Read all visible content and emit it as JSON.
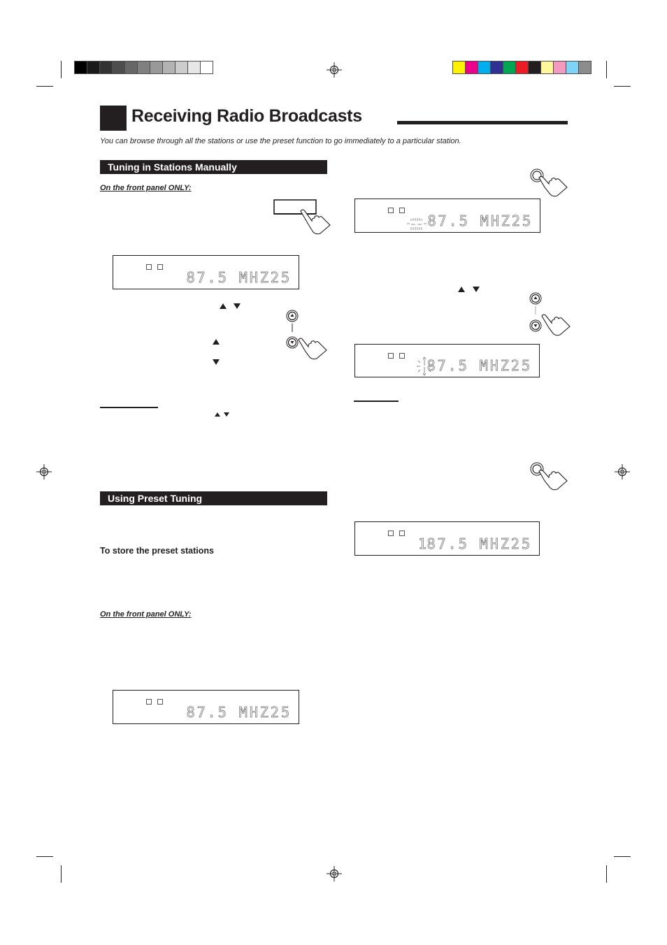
{
  "page": {
    "title": "Receiving Radio Broadcasts",
    "intro": "You can browse through all the stations or use the preset function to go immediately to a particular station."
  },
  "print_marks": {
    "grayscale_swatches": [
      "#000000",
      "#1a1a1a",
      "#333333",
      "#4d4d4d",
      "#666666",
      "#808080",
      "#999999",
      "#b3b3b3",
      "#cccccc",
      "#e6e6e6",
      "#ffffff"
    ],
    "color_swatches": [
      "#fff200",
      "#ec008c",
      "#00aeef",
      "#2e3192",
      "#00a651",
      "#ed1c24",
      "#231f20",
      "#fff799",
      "#f49ac1",
      "#7fd3f7",
      "#8c8c8c"
    ]
  },
  "sections": {
    "manual": {
      "heading": "Tuning in Stations Manually",
      "note": "On the front panel ONLY:"
    },
    "preset": {
      "heading": "Using Preset Tuning",
      "subheading": "To store the preset stations",
      "note": "On the front panel ONLY:"
    }
  },
  "displays": {
    "manual_1": {
      "frequency": "87.5",
      "unit": "MHz",
      "band": "25"
    },
    "manual_2": {
      "frequency": "87.5",
      "unit": "MHz",
      "band": "25"
    },
    "preset_flashing": {
      "frequency": "87.5",
      "unit": "MHz",
      "band": "25",
      "preset": "--"
    },
    "preset_select": {
      "frequency": "87.5",
      "unit": "MHz",
      "band": "25",
      "preset": "1"
    },
    "preset_stored": {
      "frequency": "87.5",
      "unit": "MHz",
      "band": "25",
      "preset": "1"
    }
  },
  "display_text": {
    "manual_1": "87.5 MHZ25",
    "manual_2": "87.5 MHZ25",
    "preset_flashing": "87.5 MHZ25",
    "preset_select": "87.5 MHZ25",
    "preset_stored": "87.5 MHZ25",
    "preset_number": "1",
    "preset_blank": "--"
  }
}
